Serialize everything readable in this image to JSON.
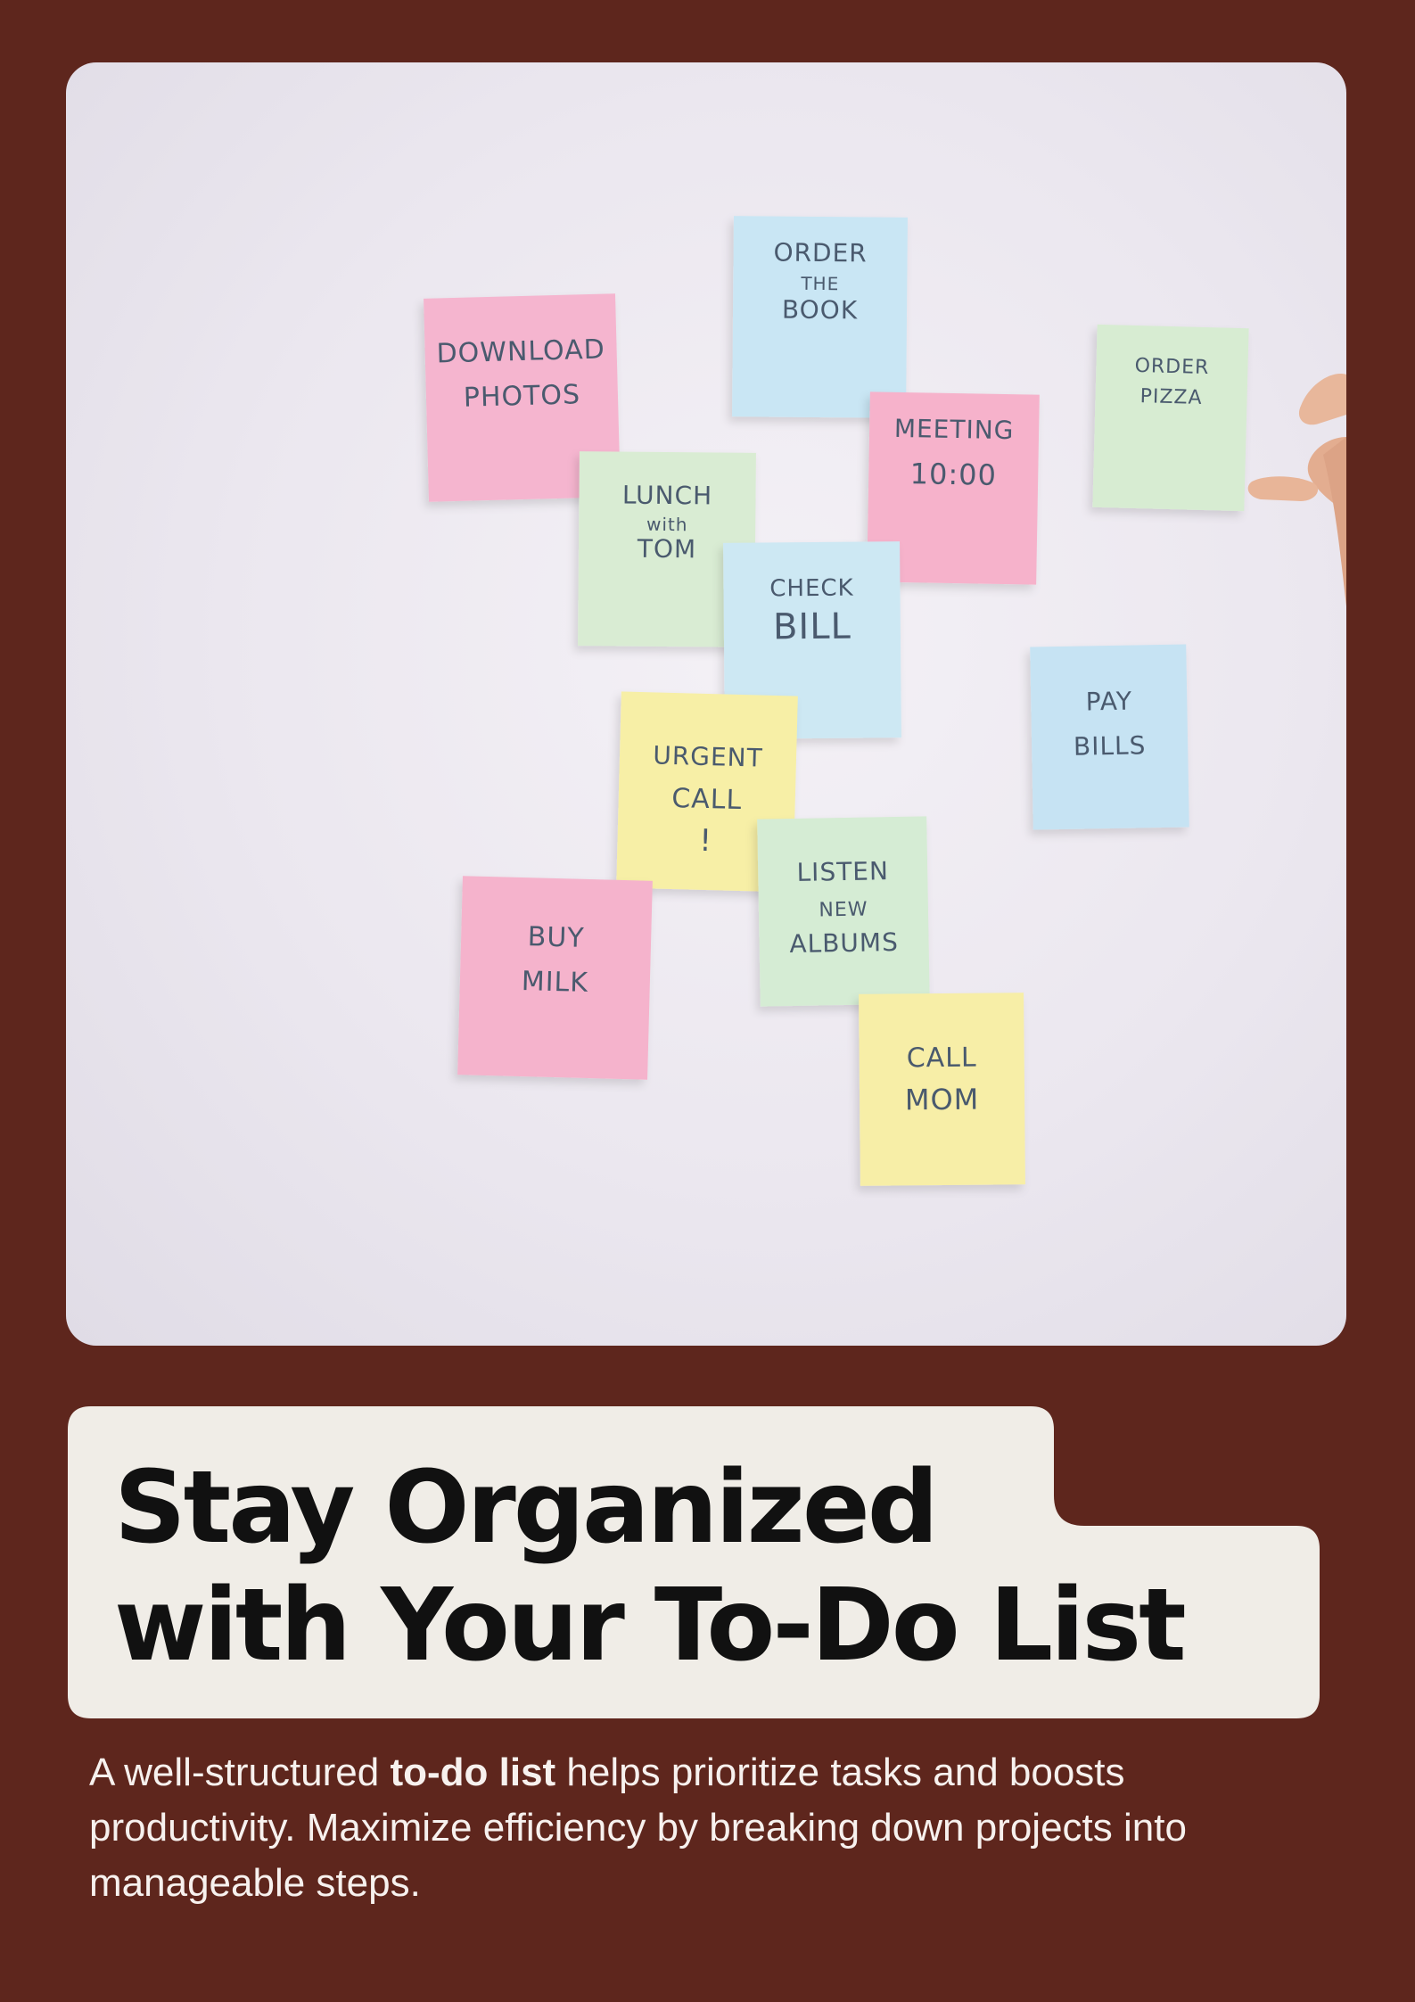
{
  "colors": {
    "background": "#5e261d",
    "card": "#f0ede7",
    "title": "#111111",
    "body_text": "#f7f1ee"
  },
  "photo": {
    "notes": [
      {
        "lines": [
          "DOWNLOAD",
          "PHOTOS"
        ],
        "color": "#f5b5cf"
      },
      {
        "lines": [
          "ORDER",
          "THE",
          "BOOK"
        ],
        "color": "#c9e6f4"
      },
      {
        "lines": [
          "ORDER",
          "PIZZA"
        ],
        "color": "#d7ecd2"
      },
      {
        "lines": [
          "MEETING",
          "10:00"
        ],
        "color": "#f6b2cb"
      },
      {
        "lines": [
          "LUNCH",
          "with",
          "TOM"
        ],
        "color": "#d9ecd3"
      },
      {
        "lines": [
          "CHECK",
          "BILL"
        ],
        "color": "#cde8f3"
      },
      {
        "lines": [
          "PAY",
          "BILLS"
        ],
        "color": "#c6e3f3"
      },
      {
        "lines": [
          "URGENT",
          "CALL",
          "!"
        ],
        "color": "#f7efa6"
      },
      {
        "lines": [
          "LISTEN",
          "NEW",
          "ALBUMS"
        ],
        "color": "#d5ecd4"
      },
      {
        "lines": [
          "BUY",
          "MILK"
        ],
        "color": "#f5b3cc"
      },
      {
        "lines": [
          "CALL",
          "MOM"
        ],
        "color": "#f7eea7"
      }
    ]
  },
  "title": {
    "line1": "Stay Organized",
    "line2": "with Your To-Do List"
  },
  "body": {
    "prefix": "A well-structured ",
    "bold": "to-do list",
    "suffix": " helps prioritize tasks and boosts productivity. Maximize efficiency by breaking down projects into manageable steps."
  }
}
